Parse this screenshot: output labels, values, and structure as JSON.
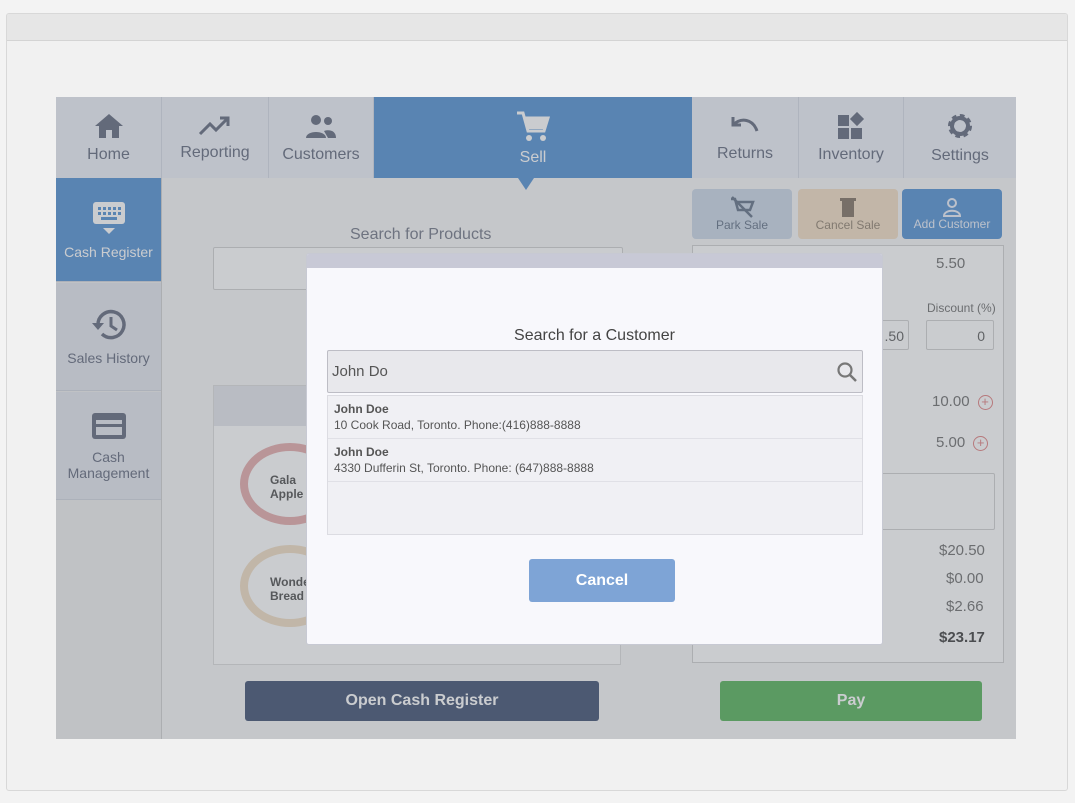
{
  "nav": {
    "home": "Home",
    "reporting": "Reporting",
    "customers": "Customers",
    "sell": "Sell",
    "returns": "Returns",
    "inventory": "Inventory",
    "settings": "Settings"
  },
  "sidebar": {
    "cash_register": "Cash Register",
    "sales_history": "Sales History",
    "cash_management": "Cash Management"
  },
  "main": {
    "search_products_label": "Search for Products",
    "park_sale": "Park Sale",
    "cancel_sale": "Cancel Sale",
    "add_customer": "Add Customer",
    "top_value": "5.50",
    "discount_label": "Discount (%)",
    "discount_value": "0",
    "price_partial": ".50",
    "line1_value": "10.00",
    "line2_value": "5.00",
    "subtotal": "$20.50",
    "discount_total": "$0.00",
    "tax": "$2.66",
    "total": "$23.17",
    "product1": "Gala Apple",
    "product2": "Wonder Bread",
    "open_register": "Open Cash Register",
    "pay": "Pay"
  },
  "modal": {
    "title": "Search for a Customer",
    "search_value": "John Do",
    "results": [
      {
        "name": "John Doe",
        "detail": "10 Cook Road, Toronto. Phone:(416)888-8888"
      },
      {
        "name": "John Doe",
        "detail": "4330 Dufferin St, Toronto. Phone: (647)888-8888"
      }
    ],
    "cancel": "Cancel"
  },
  "colors": {
    "accent": "#4a8bd1",
    "pay": "#4caf50",
    "open_register": "#34466a"
  }
}
